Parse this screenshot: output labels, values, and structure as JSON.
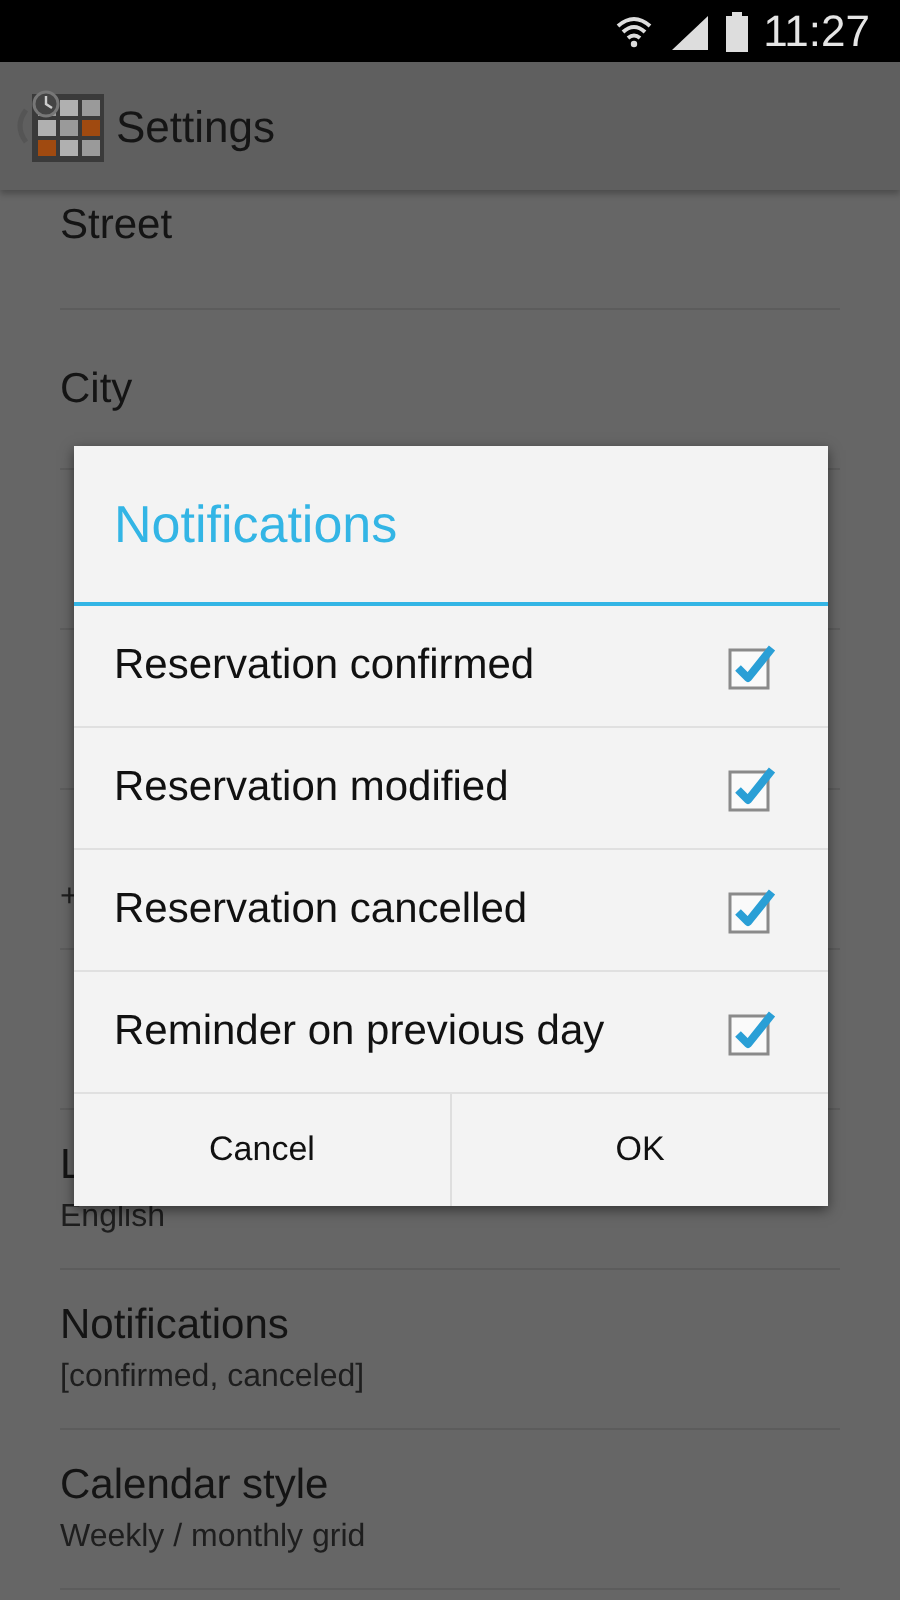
{
  "status_bar": {
    "time": "11:27"
  },
  "action_bar": {
    "title": "Settings"
  },
  "settings_top": [
    {
      "title": "Street"
    },
    {
      "title": "City"
    }
  ],
  "settings_middle": [
    {
      "subtitle": "+"
    }
  ],
  "settings_bottom": [
    {
      "title": "L",
      "subtitle": "English"
    },
    {
      "title": "Notifications",
      "subtitle": "[confirmed, canceled]"
    },
    {
      "title": "Calendar style",
      "subtitle": "Weekly / monthly grid"
    }
  ],
  "dialog": {
    "title": "Notifications",
    "options": [
      {
        "label": "Reservation confirmed",
        "checked": true
      },
      {
        "label": "Reservation modified",
        "checked": true
      },
      {
        "label": "Reservation cancelled",
        "checked": true
      },
      {
        "label": "Reminder on previous day",
        "checked": true
      }
    ],
    "buttons": [
      "Cancel",
      "OK"
    ]
  }
}
